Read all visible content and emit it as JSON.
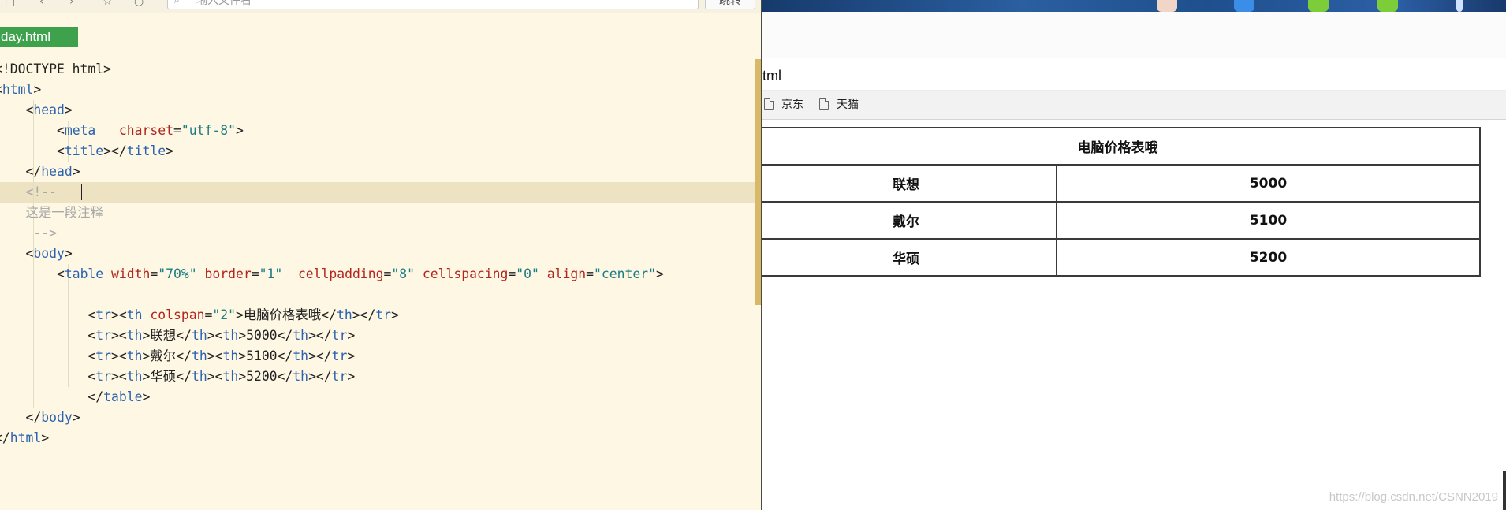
{
  "editor": {
    "toolbar": {
      "search_placeholder": "输入文件名",
      "go_label": "跳转"
    },
    "file_tab": "day.html",
    "lines": [
      {
        "segments": [
          {
            "t": "b",
            "v": "<!DOCTYPE html>"
          }
        ]
      },
      {
        "segments": [
          {
            "t": "b",
            "v": "<"
          },
          {
            "t": "t",
            "v": "html"
          },
          {
            "t": "b",
            "v": ">"
          }
        ]
      },
      {
        "segments": [
          {
            "t": "x",
            "v": "    "
          },
          {
            "t": "b",
            "v": "<"
          },
          {
            "t": "t",
            "v": "head"
          },
          {
            "t": "b",
            "v": ">"
          }
        ]
      },
      {
        "segments": [
          {
            "t": "x",
            "v": "        "
          },
          {
            "t": "b",
            "v": "<"
          },
          {
            "t": "t",
            "v": "meta"
          },
          {
            "t": "x",
            "v": "   "
          },
          {
            "t": "a",
            "v": "charset"
          },
          {
            "t": "b",
            "v": "="
          },
          {
            "t": "s",
            "v": "\"utf-8\""
          },
          {
            "t": "b",
            "v": ">"
          }
        ]
      },
      {
        "segments": [
          {
            "t": "x",
            "v": "        "
          },
          {
            "t": "b",
            "v": "<"
          },
          {
            "t": "t",
            "v": "title"
          },
          {
            "t": "b",
            "v": "></"
          },
          {
            "t": "t",
            "v": "title"
          },
          {
            "t": "b",
            "v": ">"
          }
        ]
      },
      {
        "segments": [
          {
            "t": "x",
            "v": "    "
          },
          {
            "t": "b",
            "v": "</"
          },
          {
            "t": "t",
            "v": "head"
          },
          {
            "t": "b",
            "v": ">"
          }
        ]
      },
      {
        "segments": [
          {
            "t": "x",
            "v": "    "
          },
          {
            "t": "c",
            "v": "<!--"
          }
        ],
        "highlight": true
      },
      {
        "segments": [
          {
            "t": "x",
            "v": "    "
          },
          {
            "t": "c",
            "v": "这是一段注释"
          }
        ]
      },
      {
        "segments": [
          {
            "t": "x",
            "v": "     "
          },
          {
            "t": "c",
            "v": "-->"
          }
        ]
      },
      {
        "segments": [
          {
            "t": "x",
            "v": "    "
          },
          {
            "t": "b",
            "v": "<"
          },
          {
            "t": "t",
            "v": "body"
          },
          {
            "t": "b",
            "v": ">"
          }
        ]
      },
      {
        "segments": [
          {
            "t": "x",
            "v": "        "
          },
          {
            "t": "b",
            "v": "<"
          },
          {
            "t": "t",
            "v": "table"
          },
          {
            "t": "x",
            "v": " "
          },
          {
            "t": "a",
            "v": "width"
          },
          {
            "t": "b",
            "v": "="
          },
          {
            "t": "s",
            "v": "\"70%\""
          },
          {
            "t": "x",
            "v": " "
          },
          {
            "t": "a",
            "v": "border"
          },
          {
            "t": "b",
            "v": "="
          },
          {
            "t": "s",
            "v": "\"1\""
          },
          {
            "t": "x",
            "v": "  "
          },
          {
            "t": "a",
            "v": "cellpadding"
          },
          {
            "t": "b",
            "v": "="
          },
          {
            "t": "s",
            "v": "\"8\""
          },
          {
            "t": "x",
            "v": " "
          },
          {
            "t": "a",
            "v": "cellspacing"
          },
          {
            "t": "b",
            "v": "="
          },
          {
            "t": "s",
            "v": "\"0\""
          },
          {
            "t": "x",
            "v": " "
          },
          {
            "t": "a",
            "v": "align"
          },
          {
            "t": "b",
            "v": "="
          },
          {
            "t": "s",
            "v": "\"center\""
          },
          {
            "t": "b",
            "v": ">"
          }
        ]
      },
      {
        "segments": []
      },
      {
        "segments": [
          {
            "t": "x",
            "v": "            "
          },
          {
            "t": "b",
            "v": "<"
          },
          {
            "t": "t",
            "v": "tr"
          },
          {
            "t": "b",
            "v": "><"
          },
          {
            "t": "t",
            "v": "th"
          },
          {
            "t": "x",
            "v": " "
          },
          {
            "t": "a",
            "v": "colspan"
          },
          {
            "t": "b",
            "v": "="
          },
          {
            "t": "s",
            "v": "\"2\""
          },
          {
            "t": "b",
            "v": ">"
          },
          {
            "t": "x",
            "v": "电脑价格表哦"
          },
          {
            "t": "b",
            "v": "</"
          },
          {
            "t": "t",
            "v": "th"
          },
          {
            "t": "b",
            "v": "></"
          },
          {
            "t": "t",
            "v": "tr"
          },
          {
            "t": "b",
            "v": ">"
          }
        ]
      },
      {
        "segments": [
          {
            "t": "x",
            "v": "            "
          },
          {
            "t": "b",
            "v": "<"
          },
          {
            "t": "t",
            "v": "tr"
          },
          {
            "t": "b",
            "v": "><"
          },
          {
            "t": "t",
            "v": "th"
          },
          {
            "t": "b",
            "v": ">"
          },
          {
            "t": "x",
            "v": "联想"
          },
          {
            "t": "b",
            "v": "</"
          },
          {
            "t": "t",
            "v": "th"
          },
          {
            "t": "b",
            "v": "><"
          },
          {
            "t": "t",
            "v": "th"
          },
          {
            "t": "b",
            "v": ">"
          },
          {
            "t": "x",
            "v": "5000"
          },
          {
            "t": "b",
            "v": "</"
          },
          {
            "t": "t",
            "v": "th"
          },
          {
            "t": "b",
            "v": "></"
          },
          {
            "t": "t",
            "v": "tr"
          },
          {
            "t": "b",
            "v": ">"
          }
        ]
      },
      {
        "segments": [
          {
            "t": "x",
            "v": "            "
          },
          {
            "t": "b",
            "v": "<"
          },
          {
            "t": "t",
            "v": "tr"
          },
          {
            "t": "b",
            "v": "><"
          },
          {
            "t": "t",
            "v": "th"
          },
          {
            "t": "b",
            "v": ">"
          },
          {
            "t": "x",
            "v": "戴尔"
          },
          {
            "t": "b",
            "v": "</"
          },
          {
            "t": "t",
            "v": "th"
          },
          {
            "t": "b",
            "v": "><"
          },
          {
            "t": "t",
            "v": "th"
          },
          {
            "t": "b",
            "v": ">"
          },
          {
            "t": "x",
            "v": "5100"
          },
          {
            "t": "b",
            "v": "</"
          },
          {
            "t": "t",
            "v": "th"
          },
          {
            "t": "b",
            "v": "></"
          },
          {
            "t": "t",
            "v": "tr"
          },
          {
            "t": "b",
            "v": ">"
          }
        ]
      },
      {
        "segments": [
          {
            "t": "x",
            "v": "            "
          },
          {
            "t": "b",
            "v": "<"
          },
          {
            "t": "t",
            "v": "tr"
          },
          {
            "t": "b",
            "v": "><"
          },
          {
            "t": "t",
            "v": "th"
          },
          {
            "t": "b",
            "v": ">"
          },
          {
            "t": "x",
            "v": "华硕"
          },
          {
            "t": "b",
            "v": "</"
          },
          {
            "t": "t",
            "v": "th"
          },
          {
            "t": "b",
            "v": "><"
          },
          {
            "t": "t",
            "v": "th"
          },
          {
            "t": "b",
            "v": ">"
          },
          {
            "t": "x",
            "v": "5200"
          },
          {
            "t": "b",
            "v": "</"
          },
          {
            "t": "t",
            "v": "th"
          },
          {
            "t": "b",
            "v": "></"
          },
          {
            "t": "t",
            "v": "tr"
          },
          {
            "t": "b",
            "v": ">"
          }
        ]
      },
      {
        "segments": [
          {
            "t": "x",
            "v": "            "
          },
          {
            "t": "b",
            "v": "</"
          },
          {
            "t": "t",
            "v": "table"
          },
          {
            "t": "b",
            "v": ">"
          }
        ]
      },
      {
        "segments": [
          {
            "t": "x",
            "v": "    "
          },
          {
            "t": "b",
            "v": "</"
          },
          {
            "t": "t",
            "v": "body"
          },
          {
            "t": "b",
            "v": ">"
          }
        ]
      },
      {
        "segments": [
          {
            "t": "b",
            "v": "</"
          },
          {
            "t": "t",
            "v": "html"
          },
          {
            "t": "b",
            "v": ">"
          }
        ]
      }
    ]
  },
  "browser": {
    "address": "tml",
    "bookmarks": [
      "京东",
      "天猫"
    ],
    "table": {
      "caption": "电脑价格表哦",
      "rows": [
        {
          "name": "联想",
          "price": "5000"
        },
        {
          "name": "戴尔",
          "price": "5100"
        },
        {
          "name": "华硕",
          "price": "5200"
        }
      ]
    }
  },
  "watermark": "https://blog.csdn.net/CSNN2019"
}
